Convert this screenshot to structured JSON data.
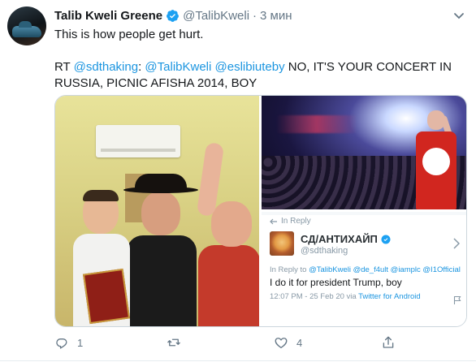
{
  "tweet": {
    "author_name": "Talib Kweli Greene",
    "author_handle": "@TalibKweli",
    "separator": "·",
    "time": "3 мин",
    "line1": "This is how people get hurt.",
    "rt_prefix": "RT ",
    "rt_mention1": "@sdthaking",
    "rt_colon": ": ",
    "rt_mention2": "@TalibKweli",
    "rt_space": " ",
    "rt_mention3": "@eslibiuteby",
    "rt_body_a": " NO, IT'S YOUR CONCERT IN",
    "rt_body_b": "RUSSIA, PICNIC AFISHA 2014, BOY"
  },
  "embedded_screenshot": {
    "in_reply_label": "In Reply",
    "author_name": "СД/АНТИХАЙП",
    "author_handle": "@sdthaking",
    "reply_prefix": "In Reply to ",
    "reply_mentions": "@TalibKweli @de_f4ult @iamplc @I1Official",
    "text": "I do it for president Trump, boy",
    "meta_prefix": "12:07 PM - 25 Feb 20 via ",
    "meta_source": "Twitter for Android"
  },
  "actions": {
    "reply_count": "1",
    "retweet_count": "",
    "like_count": "4",
    "share_count": ""
  },
  "colors": {
    "link": "#1b95e0",
    "secondary_text": "#657786",
    "verified": "#1da1f2"
  },
  "icons": [
    "verified-badge-icon",
    "chevron-down-icon",
    "reply-icon",
    "retweet-icon",
    "like-icon",
    "share-icon",
    "flag-icon"
  ]
}
